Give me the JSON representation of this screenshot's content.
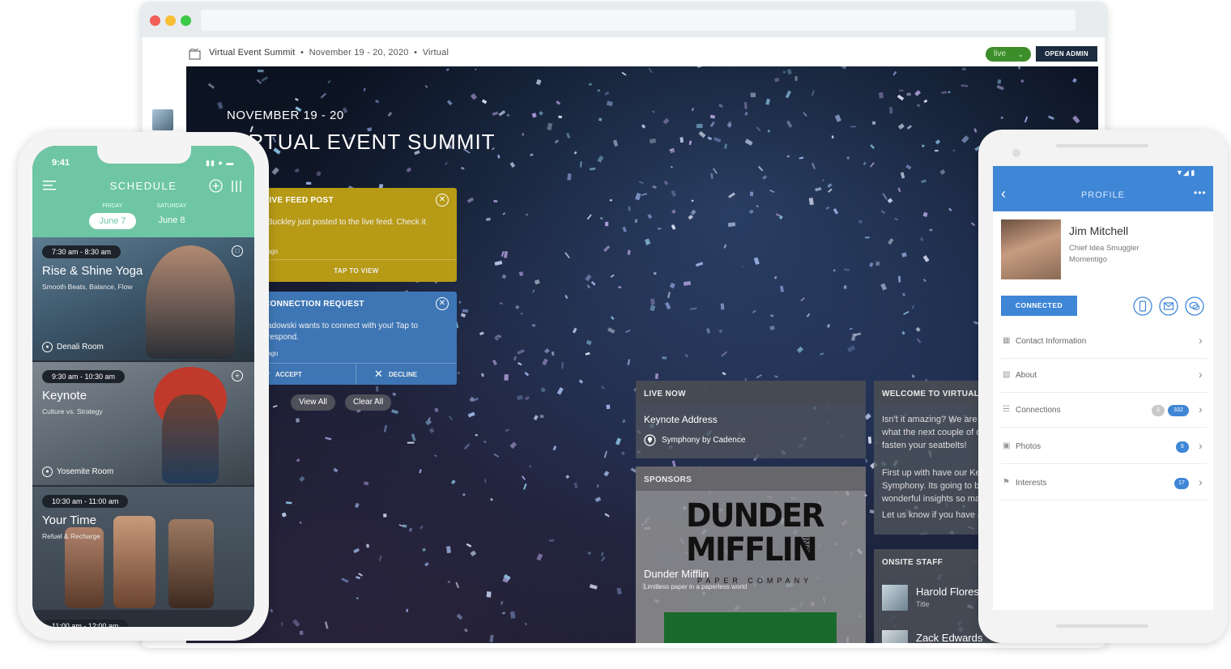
{
  "browser": {
    "event_name": "Virtual Event Summit",
    "event_dates": "November 19 - 20, 2020",
    "event_type": "Virtual",
    "live_label": "live",
    "open_admin_label": "OPEN ADMIN"
  },
  "hero": {
    "date": "NOVEMBER 19 - 20",
    "title": "VIRTUAL EVENT SUMMIT"
  },
  "notifications": {
    "live_feed": {
      "title": "LIVE FEED POST",
      "body": "Buckley just posted to the live feed. Check it",
      "time": "ago",
      "action": "TAP TO VIEW",
      "color": "#b79a16"
    },
    "connection": {
      "title": "CONNECTION REQUEST",
      "body": "adowski wants to connect with you! Tap to respond.",
      "time": "ago",
      "accept": "ACCEPT",
      "decline": "DECLINE",
      "color": "#3e76b5"
    },
    "view_all": "View All",
    "clear_all": "Clear All"
  },
  "live_now": {
    "header": "LIVE NOW",
    "session": "Keynote Address",
    "location": "Symphony by Cadence"
  },
  "sponsors": {
    "header": "SPONSORS",
    "logo_line1": "DUNDER",
    "logo_line2": "MIFFLIN",
    "logo_inc": "INC",
    "logo_company": "PAPER COMPANY",
    "name": "Dunder Mifflin",
    "tagline": "Limitless paper in a paperless world"
  },
  "welcome": {
    "header": "WELCOME TO VIRTUAL EVENT SU",
    "p1": "Isn't it amazing? We are incredi what the next couple of days w fasten your seatbelts!",
    "p2": "First up with have our Keynote Symphony. Its going to be fille wonderful insights so make sur",
    "p3": "Let us know if you have any qu"
  },
  "onsite_staff": {
    "header": "ONSITE STAFF",
    "name": "Harold Flores",
    "title": "Title",
    "next_name": "Zack Edwards"
  },
  "schedule_phone": {
    "time": "9:41",
    "title": "SCHEDULE",
    "days": [
      {
        "weekday": "FRIDAY",
        "date": "June 7"
      },
      {
        "weekday": "SATURDAY",
        "date": "June 8"
      }
    ],
    "sessions": [
      {
        "time": "7:30 am - 8:30 am",
        "name": "Rise & Shine Yoga",
        "sub": "Smooth Beats, Balance, Flow",
        "room": "Denali Room"
      },
      {
        "time": "9:30 am - 10:30 am",
        "name": "Keynote",
        "sub": "Culture vs. Strategy",
        "room": "Yosemite Room"
      },
      {
        "time": "10:30 am - 11:00 am",
        "name": "Your Time",
        "sub": "Refuel & Recharge",
        "room": ""
      }
    ],
    "next_time": "11:00 am - 12:00 am",
    "accent": "#6ec6a5"
  },
  "profile_phone": {
    "title": "PROFILE",
    "name": "Jim Mitchell",
    "role": "Chief Idea Smuggler",
    "company": "Momentigo",
    "connected_label": "CONNECTED",
    "rows": [
      {
        "label": "Contact Information",
        "badge": "",
        "badge2": ""
      },
      {
        "label": "About",
        "badge": "",
        "badge2": ""
      },
      {
        "label": "Connections",
        "badge": "3",
        "badge2": "332"
      },
      {
        "label": "Photos",
        "badge": "",
        "badge2": "6"
      },
      {
        "label": "Interests",
        "badge": "",
        "badge2": "17"
      }
    ],
    "accent": "#3f86d6"
  }
}
